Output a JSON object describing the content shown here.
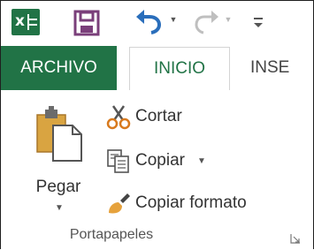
{
  "quick_access": {
    "app_icon": "excel-logo-icon",
    "save_icon": "save-icon",
    "undo_icon": "undo-icon",
    "redo_icon": "redo-icon",
    "customize_icon": "customize-toolbar-icon"
  },
  "tabs": [
    {
      "label": "ARCHIVO"
    },
    {
      "label": "INICIO"
    },
    {
      "label": "INSE"
    }
  ],
  "clipboard": {
    "paste_label": "Pegar",
    "cut_label": "Cortar",
    "copy_label": "Copiar",
    "format_painter_label": "Copiar formato",
    "group_label": "Portapapeles"
  },
  "colors": {
    "accent": "#217346",
    "text": "#333333"
  }
}
